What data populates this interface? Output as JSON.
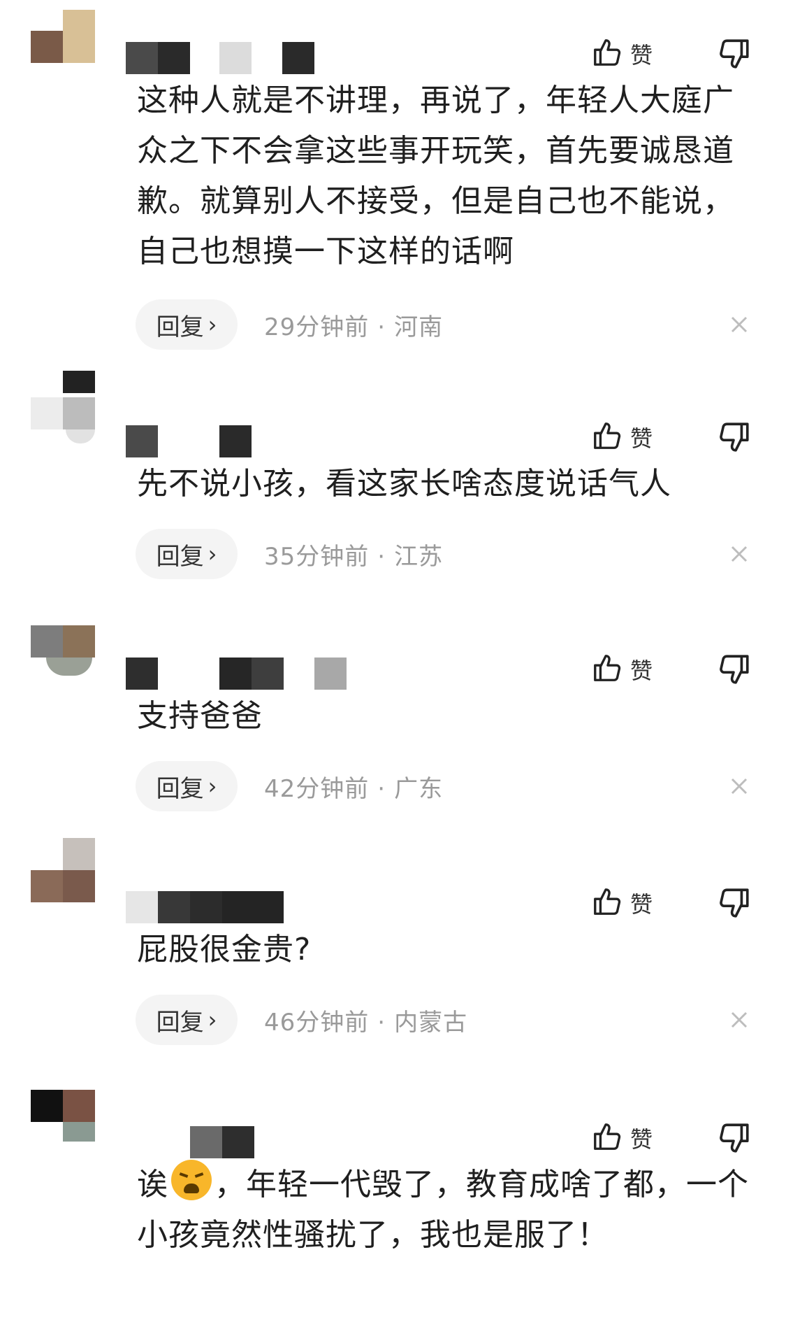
{
  "like_label": "赞",
  "reply_label": "回复",
  "colors": {
    "meta_text": "#9a9a9a",
    "reply_bg": "#f4f4f4",
    "text": "#1f1f1f"
  },
  "comments": [
    {
      "content": "这种人就是不讲理，再说了，年轻人大庭广众之下不会拿这些事开玩笑，首先要诚恳道歉。就算别人不接受，但是自己也不能说，自己也想摸一下这样的话啊",
      "time": "29分钟前",
      "region": "河南"
    },
    {
      "content": "先不说小孩，看这家长啥态度说话气人",
      "time": "35分钟前",
      "region": "江苏"
    },
    {
      "content": "支持爸爸",
      "time": "42分钟前",
      "region": "广东"
    },
    {
      "content": "屁股很金贵?",
      "time": "46分钟前",
      "region": "内蒙古"
    },
    {
      "content_before": "诶",
      "emoji_icon": "weary-face-emoji",
      "content_after": "，年轻一代毁了，教育成啥了都，一个小孩竟然性骚扰了，我也是服了！"
    }
  ]
}
